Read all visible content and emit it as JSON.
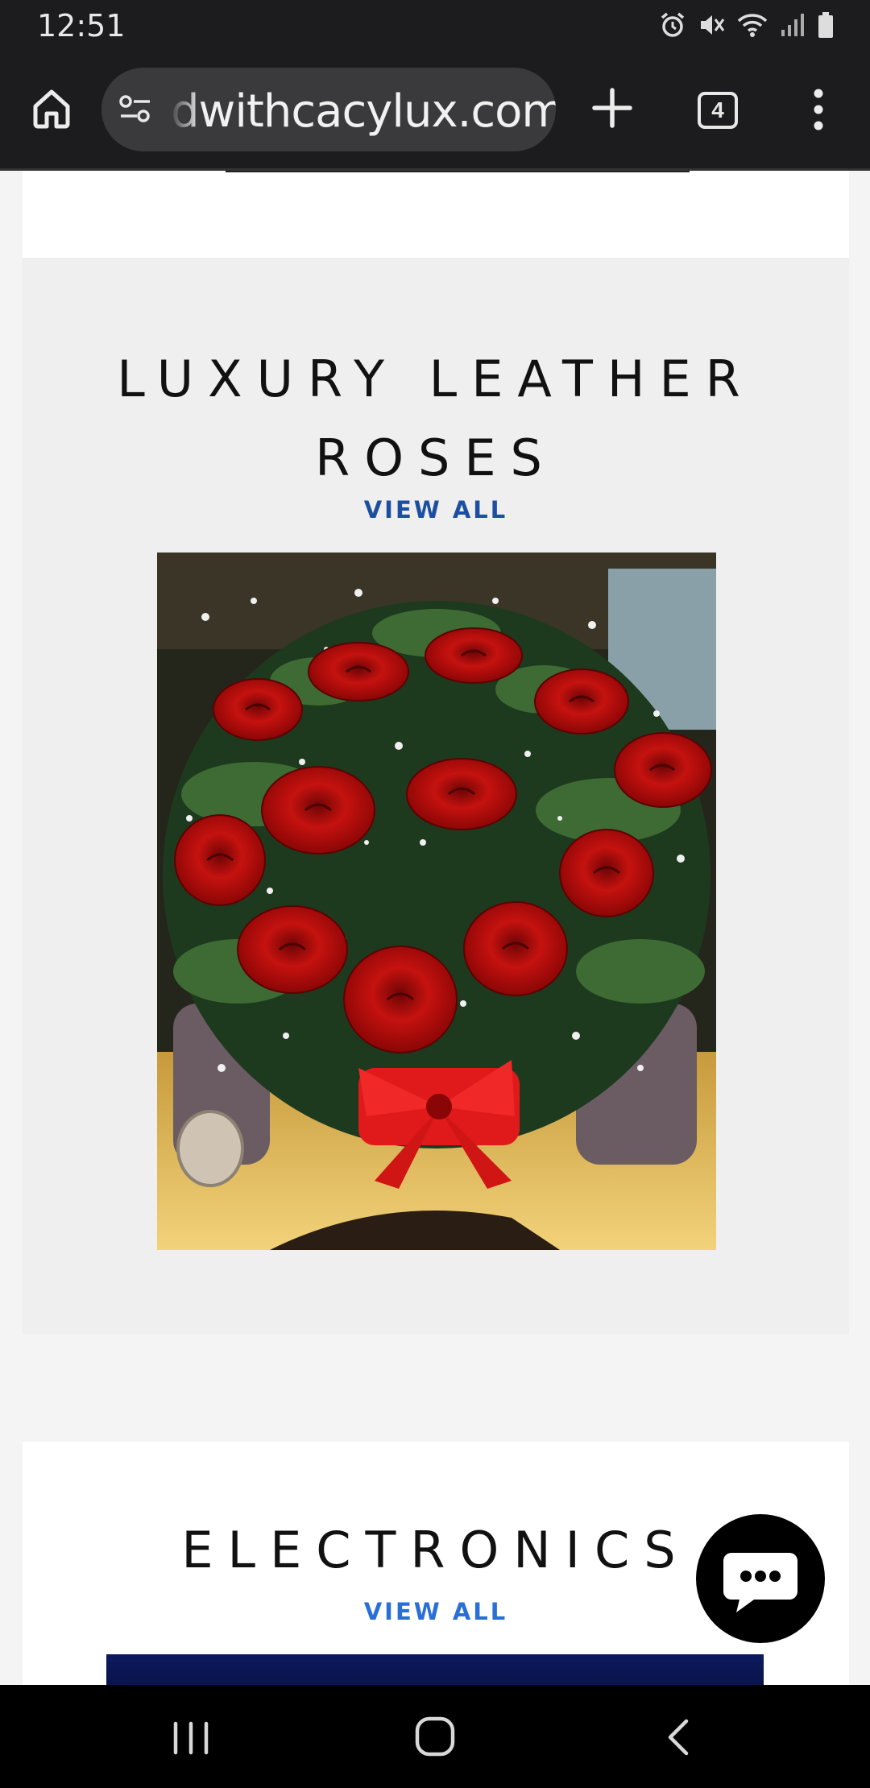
{
  "status_bar": {
    "time": "12:51",
    "icons": [
      "alarm-icon",
      "mute-icon",
      "wifi-icon",
      "signal-icon",
      "battery-icon"
    ]
  },
  "browser": {
    "url": "dwithcacylux.com",
    "tab_count": "4"
  },
  "sections": [
    {
      "title_line1": "LUXURY LEATHER",
      "title_line2": "ROSES",
      "link": "VIEW ALL"
    },
    {
      "title": "ELECTRONICS",
      "link": "VIEW ALL"
    }
  ],
  "colors": {
    "view_all_1": "#1d4fa0",
    "view_all_2": "#2a6fd6"
  }
}
